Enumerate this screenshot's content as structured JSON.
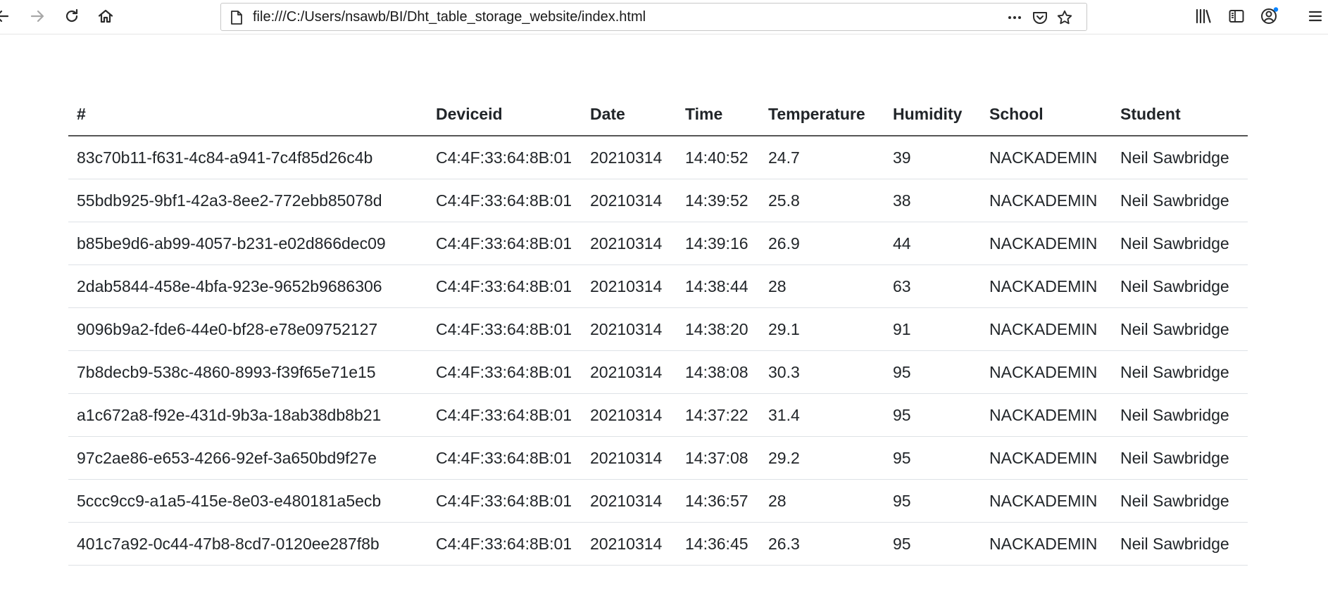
{
  "browser": {
    "url": "file:///C:/Users/nsawb/BI/Dht_table_storage_website/index.html",
    "icons": {
      "back": "back-arrow-icon",
      "forward": "forward-arrow-icon",
      "reload": "reload-icon",
      "home": "home-icon",
      "page": "page-icon",
      "more": "more-dots-icon",
      "pocket": "pocket-icon",
      "bookmark": "star-icon",
      "library": "library-icon",
      "sidebar": "sidebar-icon",
      "account": "account-icon",
      "menu": "hamburger-menu-icon"
    },
    "accent_dot_color": "#0a84ff"
  },
  "table": {
    "headers": [
      "#",
      "Deviceid",
      "Date",
      "Time",
      "Temperature",
      "Humidity",
      "School",
      "Student"
    ],
    "rows": [
      [
        "83c70b11-f631-4c84-a941-7c4f85d26c4b",
        "C4:4F:33:64:8B:01",
        "20210314",
        "14:40:52",
        "24.7",
        "39",
        "NACKADEMIN",
        "Neil Sawbridge"
      ],
      [
        "55bdb925-9bf1-42a3-8ee2-772ebb85078d",
        "C4:4F:33:64:8B:01",
        "20210314",
        "14:39:52",
        "25.8",
        "38",
        "NACKADEMIN",
        "Neil Sawbridge"
      ],
      [
        "b85be9d6-ab99-4057-b231-e02d866dec09",
        "C4:4F:33:64:8B:01",
        "20210314",
        "14:39:16",
        "26.9",
        "44",
        "NACKADEMIN",
        "Neil Sawbridge"
      ],
      [
        "2dab5844-458e-4bfa-923e-9652b9686306",
        "C4:4F:33:64:8B:01",
        "20210314",
        "14:38:44",
        "28",
        "63",
        "NACKADEMIN",
        "Neil Sawbridge"
      ],
      [
        "9096b9a2-fde6-44e0-bf28-e78e09752127",
        "C4:4F:33:64:8B:01",
        "20210314",
        "14:38:20",
        "29.1",
        "91",
        "NACKADEMIN",
        "Neil Sawbridge"
      ],
      [
        "7b8decb9-538c-4860-8993-f39f65e71e15",
        "C4:4F:33:64:8B:01",
        "20210314",
        "14:38:08",
        "30.3",
        "95",
        "NACKADEMIN",
        "Neil Sawbridge"
      ],
      [
        "a1c672a8-f92e-431d-9b3a-18ab38db8b21",
        "C4:4F:33:64:8B:01",
        "20210314",
        "14:37:22",
        "31.4",
        "95",
        "NACKADEMIN",
        "Neil Sawbridge"
      ],
      [
        "97c2ae86-e653-4266-92ef-3a650bd9f27e",
        "C4:4F:33:64:8B:01",
        "20210314",
        "14:37:08",
        "29.2",
        "95",
        "NACKADEMIN",
        "Neil Sawbridge"
      ],
      [
        "5ccc9cc9-a1a5-415e-8e03-e480181a5ecb",
        "C4:4F:33:64:8B:01",
        "20210314",
        "14:36:57",
        "28",
        "95",
        "NACKADEMIN",
        "Neil Sawbridge"
      ],
      [
        "401c7a92-0c44-47b8-8cd7-0120ee287f8b",
        "C4:4F:33:64:8B:01",
        "20210314",
        "14:36:45",
        "26.3",
        "95",
        "NACKADEMIN",
        "Neil Sawbridge"
      ]
    ]
  }
}
